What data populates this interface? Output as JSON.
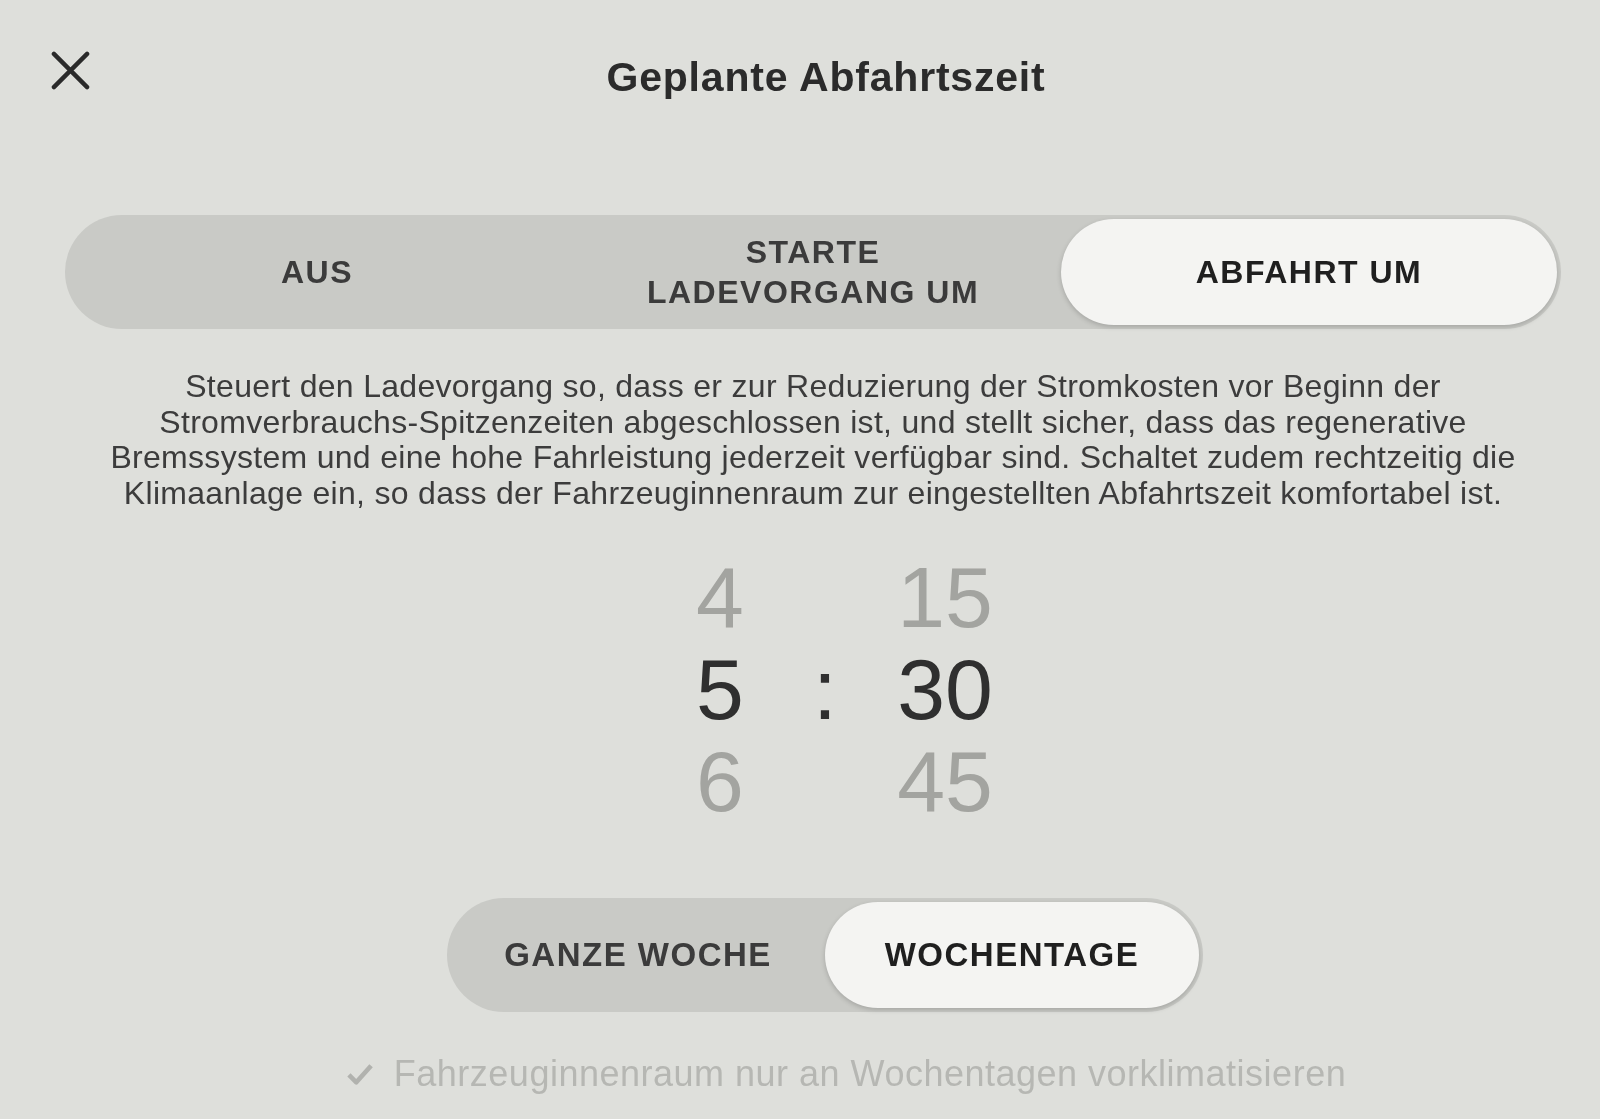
{
  "header": {
    "title": "Geplante Abfahrtszeit"
  },
  "mode_tabs": [
    {
      "label": "AUS",
      "selected": false
    },
    {
      "label": "STARTE LADEVORGANG UM",
      "selected": false
    },
    {
      "label": "ABFAHRT UM",
      "selected": true
    }
  ],
  "description": "Steuert den Ladevorgang so, dass er zur Reduzierung der Stromkosten vor Beginn der Stromverbrauchs-Spitzenzeiten abgeschlossen ist, und stellt sicher, dass das regenerative Bremssystem und eine hohe Fahrleistung jederzeit verfügbar sind. Schaltet zudem rechtzeitig die Klimaanlage ein, so dass der Fahrzeuginnenraum zur eingestellten Abfahrtszeit komfortabel ist.",
  "time_picker": {
    "hours": [
      {
        "value": "4",
        "selected": false
      },
      {
        "value": "5",
        "selected": true
      },
      {
        "value": "6",
        "selected": false
      }
    ],
    "separator": ":",
    "minutes": [
      {
        "value": "15",
        "selected": false
      },
      {
        "value": "30",
        "selected": true
      },
      {
        "value": "45",
        "selected": false
      }
    ]
  },
  "schedule_tabs": [
    {
      "label": "GANZE WOCHE",
      "selected": false
    },
    {
      "label": "WOCHENTAGE",
      "selected": true
    }
  ],
  "precondition": {
    "label": "Fahrzeuginnenraum nur an Wochentagen vorklimatisieren",
    "checked": true,
    "disabled": true
  }
}
